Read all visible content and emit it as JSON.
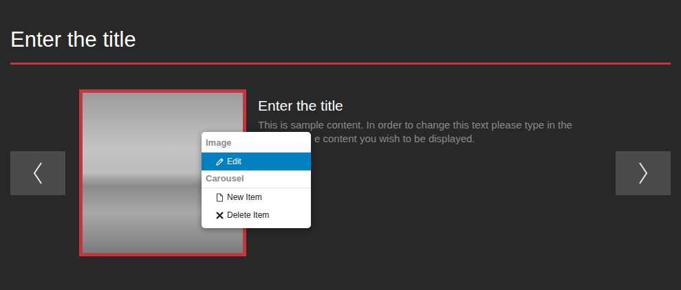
{
  "heading": "Enter the title",
  "carousel": {
    "item": {
      "title": "Enter the title",
      "description_lines": [
        "This is sample content. In order to change this text please type in the",
        "e content you wish to be displayed."
      ]
    }
  },
  "context_menu": {
    "sections": [
      {
        "title": "Image",
        "items": [
          {
            "label": "Edit",
            "selected": true
          }
        ]
      },
      {
        "title": "Carousel",
        "items": [
          {
            "label": "New Item",
            "selected": false
          },
          {
            "label": "Delete Item",
            "selected": false
          }
        ]
      }
    ]
  }
}
